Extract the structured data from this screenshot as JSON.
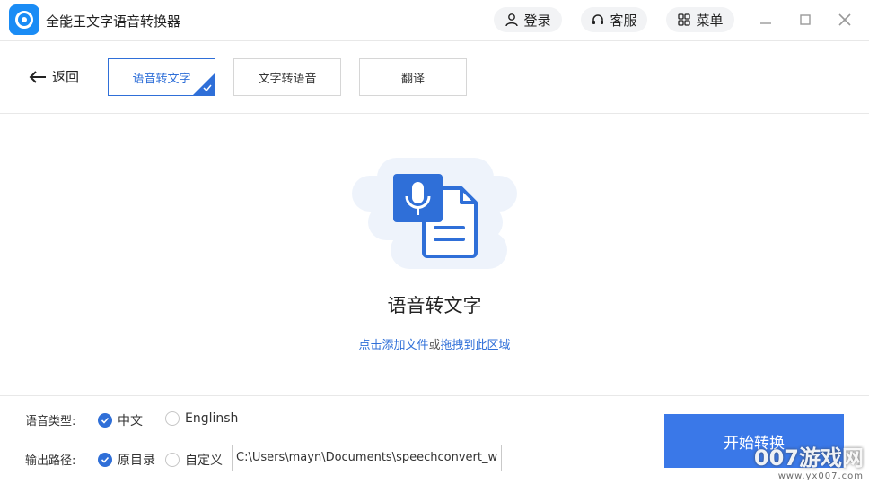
{
  "app": {
    "title": "全能王文字语音转换器"
  },
  "header": {
    "login_label": "登录",
    "service_label": "客服",
    "menu_label": "菜单"
  },
  "toolbar": {
    "back_label": "返回",
    "tabs": [
      {
        "label": "语音转文字",
        "active": true
      },
      {
        "label": "文字转语音",
        "active": false
      },
      {
        "label": "翻译",
        "active": false
      }
    ]
  },
  "dropzone": {
    "title": "语音转文字",
    "hint_link1": "点击添加文件",
    "hint_or": "或",
    "hint_link2": "拖拽到此区域"
  },
  "options": {
    "language_label": "语音类型:",
    "language_options": [
      {
        "label": "中文",
        "checked": true
      },
      {
        "label": "Englinsh",
        "checked": false
      }
    ],
    "output_label": "输出路径:",
    "output_options": [
      {
        "label": "原目录",
        "checked": true
      },
      {
        "label": "自定义",
        "checked": false
      }
    ],
    "output_path": "C:\\Users\\mayn\\Documents\\speechconvert_w"
  },
  "start_button_label": "开始转换",
  "watermark": {
    "brand": "007游戏网",
    "url": "www.yx007.com"
  },
  "colors": {
    "accent": "#2f6fd8",
    "logo": "#1a8cf5",
    "start_button": "#3a78e8"
  }
}
